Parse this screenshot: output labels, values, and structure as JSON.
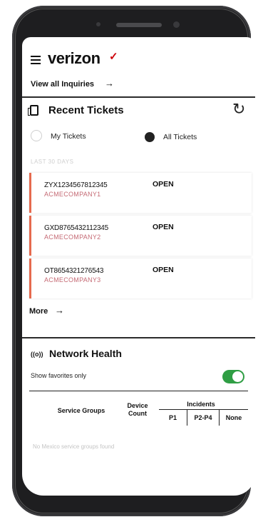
{
  "header": {
    "brand": "verizon",
    "brand_mark": "✓",
    "inquiries_link": "View all Inquiries",
    "inquiries_arrow": "→"
  },
  "recent_tickets": {
    "title": "Recent Tickets",
    "refresh_icon": "refresh-icon",
    "filters": [
      {
        "label": "My Tickets",
        "selected": false
      },
      {
        "label": "All Tickets",
        "selected": true
      }
    ],
    "section_label": "LAST 30 DAYS",
    "tickets": [
      {
        "id": "ZYX1234567812345",
        "company": "ACMECOMPANY1",
        "status": "OPEN"
      },
      {
        "id": "GXD8765432112345",
        "company": "ACMECOMPANY2",
        "status": "OPEN"
      },
      {
        "id": "OT8654321276543",
        "company": "ACMECOMPANY3",
        "status": "OPEN"
      }
    ],
    "more_link": "More",
    "more_arrow": "→"
  },
  "network_health": {
    "icon": "((o))",
    "title": "Network Health",
    "favorites_label": "Show favorites only",
    "favorites_on": true,
    "table": {
      "col_service_groups": "Service Groups",
      "col_device_count": "Device Count",
      "col_incidents": "Incidents",
      "sub_cols": [
        "P1",
        "P2-P4",
        "None"
      ]
    },
    "empty_message": "No Mexico service groups found"
  },
  "colors": {
    "brand_red": "#cd040b",
    "ticket_accent": "#e66a4e",
    "toggle_on": "#2f9e44"
  }
}
